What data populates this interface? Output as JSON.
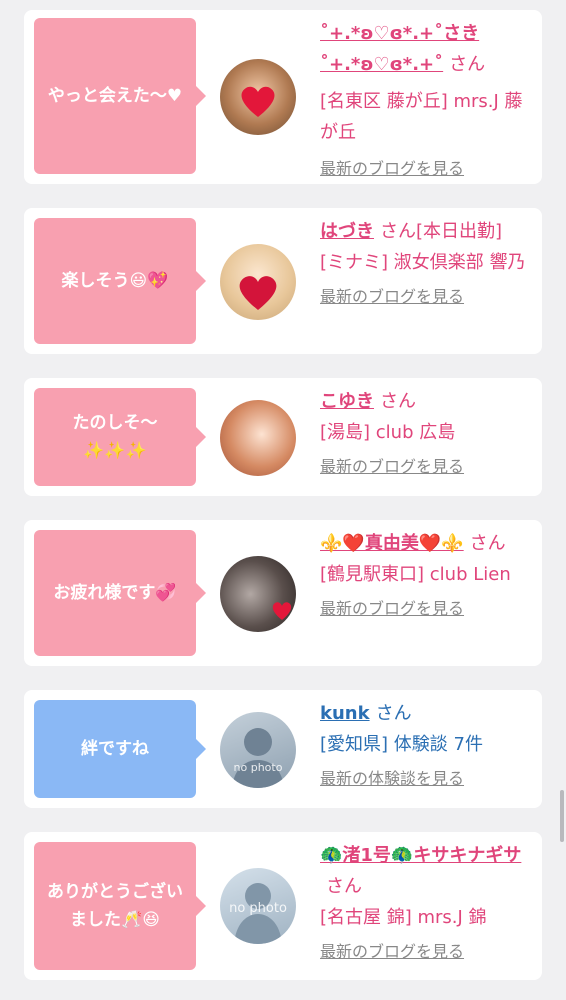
{
  "cards": [
    {
      "message": "やっと会えた〜♥",
      "name": "˚+.*ʚ♡ɞ*.+˚さき˚+.*ʚ♡ɞ*.+˚",
      "san": "さん",
      "line2": "[名東区 藤が丘] mrs.J 藤が丘",
      "link": "最新のブログを見る",
      "avatar": "girl-with-heart-photo"
    },
    {
      "message": "楽しそう😃💖",
      "name": "はづき",
      "san": "さん[本日出勤]",
      "line2": "[ミナミ] 淑女倶楽部 響乃",
      "link": "最新のブログを見る",
      "avatar": "blonde-girl-with-heart-photo"
    },
    {
      "message": "たのしそ〜✨✨✨",
      "name": "こゆき",
      "san": "さん",
      "line2": "[湯島] club 広島",
      "link": "最新のブログを見る",
      "avatar": "auburn-hair-girl-photo"
    },
    {
      "message": "お疲れ様です💞",
      "name": "⚜️❤️真由美❤️⚜️",
      "san": "さん",
      "line2": "[鶴見駅東口] club Lien",
      "link": "最新のブログを見る",
      "avatar": "dark-hair-girl-with-heart-photo"
    },
    {
      "message": "絆ですね",
      "name": "kunk",
      "san": "さん",
      "line2": "[愛知県] 体験談 7件",
      "link": "最新の体験談を見る",
      "avatar": "no-photo-male-silhouette",
      "avatar_text": "no photo"
    },
    {
      "message": "ありがとうございました🥂😆",
      "name": "🦚渚1号🦚キサキナギサ",
      "san": "さん",
      "line2": "[名古屋 錦] mrs.J 錦",
      "link": "最新のブログを見る",
      "avatar": "no-photo-female-silhouette",
      "avatar_text": "no photo"
    }
  ],
  "colors": {
    "pink_bubble": "#f8a0b0",
    "blue_bubble": "#8ab8f5",
    "pink_text": "#e0457b",
    "blue_text": "#2b6fb3",
    "link_gray": "#888888",
    "background": "#f0f0f2"
  }
}
